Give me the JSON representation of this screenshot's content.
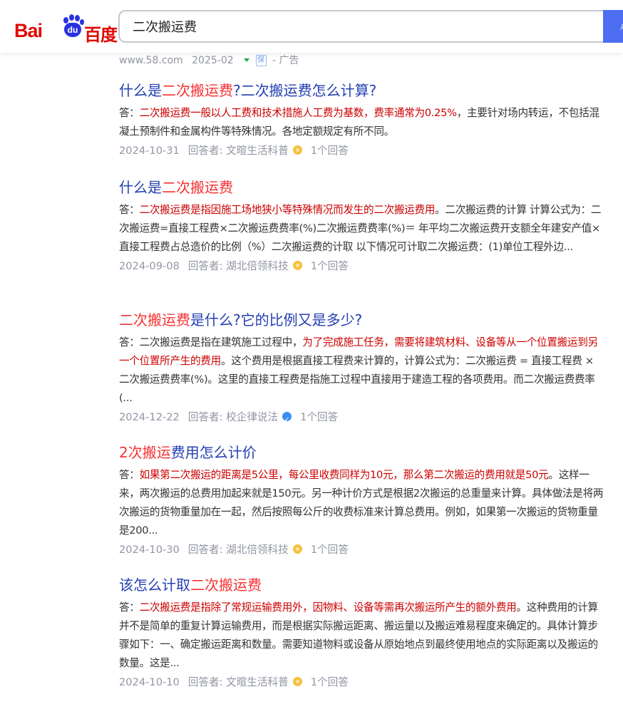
{
  "header": {
    "logo_en": "Bai",
    "logo_du": "du",
    "logo_cn": "百度",
    "search_value": "二次搬运费",
    "search_button_icon": "search-icon"
  },
  "ad": {
    "domain": "www.58.com",
    "date": "2025-02",
    "shield_text": "保",
    "label": "- 广告"
  },
  "results": [
    {
      "title_parts": [
        {
          "t": "什么是",
          "hl": false
        },
        {
          "t": "二次搬运费",
          "hl": true
        },
        {
          "t": "?二次搬运费怎么计算?",
          "hl": false
        }
      ],
      "abstract_parts": [
        {
          "t": "答：",
          "hl": false
        },
        {
          "t": "二次搬运费一般以人工费和技术措施人工费为基数，费率通常为0.25%",
          "hl": true
        },
        {
          "t": "，主要针对场内转运，不包括混凝土预制件和金属构件等特殊情况。各地定额规定有所不同。",
          "hl": false
        }
      ],
      "date": "2024-10-31",
      "answerer": "回答者: 文暄生活科普",
      "badge": "gold",
      "count": "1个回答"
    },
    {
      "title_parts": [
        {
          "t": "什么是",
          "hl": false
        },
        {
          "t": "二次搬运费",
          "hl": true
        }
      ],
      "abstract_parts": [
        {
          "t": "答：",
          "hl": false
        },
        {
          "t": "二次搬运费是指因施工场地狭小等特殊情况而发生的二次搬运费用",
          "hl": true
        },
        {
          "t": "。二次搬运费的计算 计算公式为：二次搬运费=直接工程费×二次搬运费费率(%)二次搬运费费率(%)＝ 年平均二次搬运费开支额全年建安产值×直接工程费占总造价的比例（%）二次搬运费的计取 以下情况可计取二次搬运费：(1)单位工程外边...",
          "hl": false
        }
      ],
      "date": "2024-09-08",
      "answerer": "回答者: 湖北倍领科技",
      "badge": "gold",
      "count": "1个回答"
    },
    {
      "title_parts": [
        {
          "t": "二次搬运费",
          "hl": true
        },
        {
          "t": "是什么?它的比例又是多少?",
          "hl": false
        }
      ],
      "abstract_parts": [
        {
          "t": "答：二次搬运费是指在建筑施工过程中，",
          "hl": false
        },
        {
          "t": "为了完成施工任务，需要将建筑材料、设备等从一个位置搬运到另一个位置所产生的费用",
          "hl": true
        },
        {
          "t": "。这个费用是根据直接工程费来计算的，计算公式为：二次搬运费 = 直接工程费 × 二次搬运费费率(%)。这里的直接工程费是指施工过程中直接用于建造工程的各项费用。而二次搬运费费率(...",
          "hl": false
        }
      ],
      "date": "2024-12-22",
      "answerer": "回答者: 校企律说法",
      "badge": "blue",
      "count": "1个回答"
    },
    {
      "title_parts": [
        {
          "t": "2次搬运",
          "hl": true
        },
        {
          "t": "费用怎么计价",
          "hl": false
        }
      ],
      "abstract_parts": [
        {
          "t": "答：",
          "hl": false
        },
        {
          "t": "如果第二次搬运的距离是5公里，每公里收费同样为10元，那么第二次搬运的费用就是50元",
          "hl": true
        },
        {
          "t": "。这样一来，两次搬运的总费用加起来就是150元。另一种计价方式是根据2次搬运的总重量来计算。具体做法是将两次搬运的货物重量加在一起，然后按照每公斤的收费标准来计算总费用。例如，如果第一次搬运的货物重量是200...",
          "hl": false
        }
      ],
      "date": "2024-10-30",
      "answerer": "回答者: 湖北倍领科技",
      "badge": "gold",
      "count": "1个回答"
    },
    {
      "title_parts": [
        {
          "t": "该怎么计取",
          "hl": false
        },
        {
          "t": "二次搬运费",
          "hl": true
        }
      ],
      "abstract_parts": [
        {
          "t": "答：",
          "hl": false
        },
        {
          "t": "二次搬运费是指除了常规运输费用外，因物料、设备等需再次搬运所产生的额外费用",
          "hl": true
        },
        {
          "t": "。这种费用的计算并不是简单的重复计算运输费用，而是根据实际搬运距离、搬运量以及搬运难易程度来确定的。具体计算步骤如下：一、确定搬运距离和数量。需要知道物料或设备从原始地点到最终使用地点的实际距离以及搬运的数量。这是...",
          "hl": false
        }
      ],
      "date": "2024-10-10",
      "answerer": "回答者: 文暄生活科普",
      "badge": "gold",
      "count": "1个回答"
    }
  ]
}
